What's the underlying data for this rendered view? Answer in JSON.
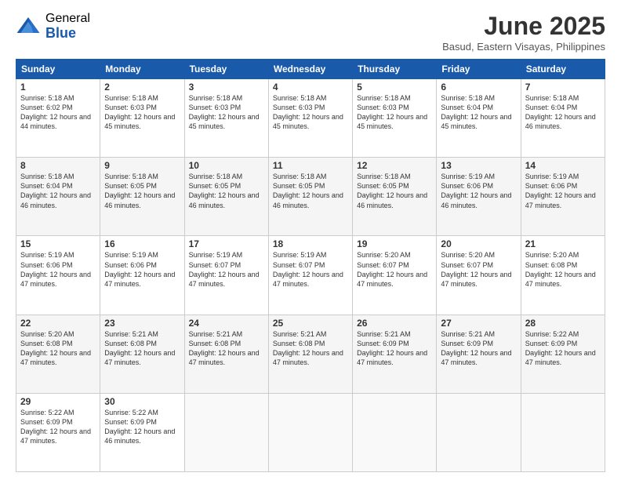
{
  "logo": {
    "general": "General",
    "blue": "Blue"
  },
  "title": {
    "month_year": "June 2025",
    "location": "Basud, Eastern Visayas, Philippines"
  },
  "weekdays": [
    "Sunday",
    "Monday",
    "Tuesday",
    "Wednesday",
    "Thursday",
    "Friday",
    "Saturday"
  ],
  "weeks": [
    [
      {
        "day": "1",
        "sunrise": "5:18 AM",
        "sunset": "6:02 PM",
        "daylight": "12 hours and 44 minutes."
      },
      {
        "day": "2",
        "sunrise": "5:18 AM",
        "sunset": "6:03 PM",
        "daylight": "12 hours and 45 minutes."
      },
      {
        "day": "3",
        "sunrise": "5:18 AM",
        "sunset": "6:03 PM",
        "daylight": "12 hours and 45 minutes."
      },
      {
        "day": "4",
        "sunrise": "5:18 AM",
        "sunset": "6:03 PM",
        "daylight": "12 hours and 45 minutes."
      },
      {
        "day": "5",
        "sunrise": "5:18 AM",
        "sunset": "6:03 PM",
        "daylight": "12 hours and 45 minutes."
      },
      {
        "day": "6",
        "sunrise": "5:18 AM",
        "sunset": "6:04 PM",
        "daylight": "12 hours and 45 minutes."
      },
      {
        "day": "7",
        "sunrise": "5:18 AM",
        "sunset": "6:04 PM",
        "daylight": "12 hours and 46 minutes."
      }
    ],
    [
      {
        "day": "8",
        "sunrise": "5:18 AM",
        "sunset": "6:04 PM",
        "daylight": "12 hours and 46 minutes."
      },
      {
        "day": "9",
        "sunrise": "5:18 AM",
        "sunset": "6:05 PM",
        "daylight": "12 hours and 46 minutes."
      },
      {
        "day": "10",
        "sunrise": "5:18 AM",
        "sunset": "6:05 PM",
        "daylight": "12 hours and 46 minutes."
      },
      {
        "day": "11",
        "sunrise": "5:18 AM",
        "sunset": "6:05 PM",
        "daylight": "12 hours and 46 minutes."
      },
      {
        "day": "12",
        "sunrise": "5:18 AM",
        "sunset": "6:05 PM",
        "daylight": "12 hours and 46 minutes."
      },
      {
        "day": "13",
        "sunrise": "5:19 AM",
        "sunset": "6:06 PM",
        "daylight": "12 hours and 46 minutes."
      },
      {
        "day": "14",
        "sunrise": "5:19 AM",
        "sunset": "6:06 PM",
        "daylight": "12 hours and 47 minutes."
      }
    ],
    [
      {
        "day": "15",
        "sunrise": "5:19 AM",
        "sunset": "6:06 PM",
        "daylight": "12 hours and 47 minutes."
      },
      {
        "day": "16",
        "sunrise": "5:19 AM",
        "sunset": "6:06 PM",
        "daylight": "12 hours and 47 minutes."
      },
      {
        "day": "17",
        "sunrise": "5:19 AM",
        "sunset": "6:07 PM",
        "daylight": "12 hours and 47 minutes."
      },
      {
        "day": "18",
        "sunrise": "5:19 AM",
        "sunset": "6:07 PM",
        "daylight": "12 hours and 47 minutes."
      },
      {
        "day": "19",
        "sunrise": "5:20 AM",
        "sunset": "6:07 PM",
        "daylight": "12 hours and 47 minutes."
      },
      {
        "day": "20",
        "sunrise": "5:20 AM",
        "sunset": "6:07 PM",
        "daylight": "12 hours and 47 minutes."
      },
      {
        "day": "21",
        "sunrise": "5:20 AM",
        "sunset": "6:08 PM",
        "daylight": "12 hours and 47 minutes."
      }
    ],
    [
      {
        "day": "22",
        "sunrise": "5:20 AM",
        "sunset": "6:08 PM",
        "daylight": "12 hours and 47 minutes."
      },
      {
        "day": "23",
        "sunrise": "5:21 AM",
        "sunset": "6:08 PM",
        "daylight": "12 hours and 47 minutes."
      },
      {
        "day": "24",
        "sunrise": "5:21 AM",
        "sunset": "6:08 PM",
        "daylight": "12 hours and 47 minutes."
      },
      {
        "day": "25",
        "sunrise": "5:21 AM",
        "sunset": "6:08 PM",
        "daylight": "12 hours and 47 minutes."
      },
      {
        "day": "26",
        "sunrise": "5:21 AM",
        "sunset": "6:09 PM",
        "daylight": "12 hours and 47 minutes."
      },
      {
        "day": "27",
        "sunrise": "5:21 AM",
        "sunset": "6:09 PM",
        "daylight": "12 hours and 47 minutes."
      },
      {
        "day": "28",
        "sunrise": "5:22 AM",
        "sunset": "6:09 PM",
        "daylight": "12 hours and 47 minutes."
      }
    ],
    [
      {
        "day": "29",
        "sunrise": "5:22 AM",
        "sunset": "6:09 PM",
        "daylight": "12 hours and 47 minutes."
      },
      {
        "day": "30",
        "sunrise": "5:22 AM",
        "sunset": "6:09 PM",
        "daylight": "12 hours and 46 minutes."
      },
      null,
      null,
      null,
      null,
      null
    ]
  ]
}
